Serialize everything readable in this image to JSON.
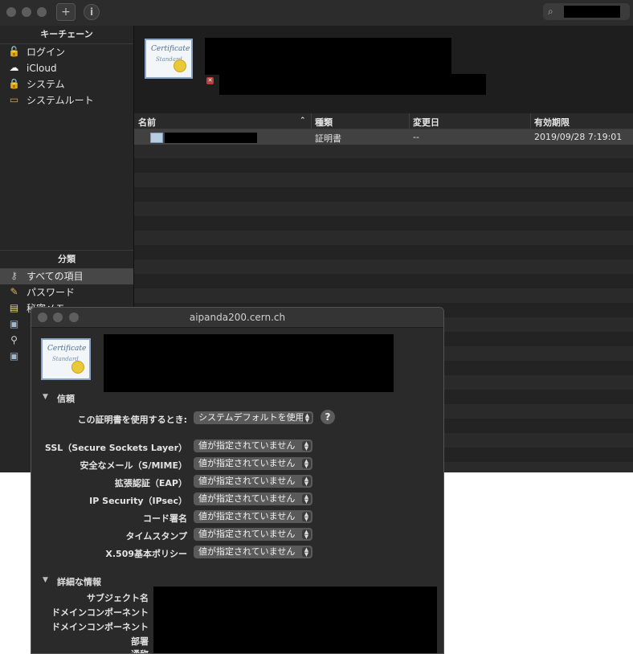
{
  "toolbar": {
    "add_button": "+",
    "info_button": "i"
  },
  "sidebar": {
    "keychains_header": "キーチェーン",
    "keychains": [
      {
        "label": "ログイン",
        "icon": "unlocked-padlock-icon"
      },
      {
        "label": "iCloud",
        "icon": "cloud-icon"
      },
      {
        "label": "システム",
        "icon": "locked-padlock-icon"
      },
      {
        "label": "システムルート",
        "icon": "folder-icon"
      }
    ],
    "category_header": "分類",
    "categories": [
      {
        "label": "すべての項目",
        "icon": "all-items-icon",
        "selected": true
      },
      {
        "label": "パスワード",
        "icon": "pencil-icon"
      },
      {
        "label": "秘密メモ",
        "icon": "note-icon"
      }
    ]
  },
  "cert_icon": {
    "line1": "Certificate",
    "line2": "Standard"
  },
  "table": {
    "columns": [
      "名前",
      "種類",
      "変更日",
      "有効期限"
    ],
    "rows": [
      {
        "name": "",
        "kind": "証明書",
        "modified": "--",
        "expires": "2019/09/28 7:19:01"
      }
    ]
  },
  "dialog": {
    "title": "aipanda200.cern.ch",
    "trust_section": "信頼",
    "when_using_label": "この証明書を使用するとき:",
    "when_using_value": "システムデフォルトを使用",
    "help": "?",
    "policies": [
      {
        "label": "SSL（Secure Sockets Layer）",
        "value": "値が指定されていません"
      },
      {
        "label": "安全なメール（S/MIME）",
        "value": "値が指定されていません"
      },
      {
        "label": "拡張認証（EAP）",
        "value": "値が指定されていません"
      },
      {
        "label": "IP Security（IPsec）",
        "value": "値が指定されていません"
      },
      {
        "label": "コード署名",
        "value": "値が指定されていません"
      },
      {
        "label": "タイムスタンプ",
        "value": "値が指定されていません"
      },
      {
        "label": "X.509基本ポリシー",
        "value": "値が指定されていません"
      }
    ],
    "details_section": "詳細な情報",
    "details": [
      "サブジェクト名",
      "ドメインコンポーネント",
      "ドメインコンポーネント",
      "部署",
      "通称"
    ]
  },
  "colors": {
    "window_bg": "#1f1f1f",
    "sidebar_bg": "#262626",
    "selection": "#474747",
    "popup_bg": "#5a5a5a",
    "cert_seal": "#e9c93a"
  }
}
